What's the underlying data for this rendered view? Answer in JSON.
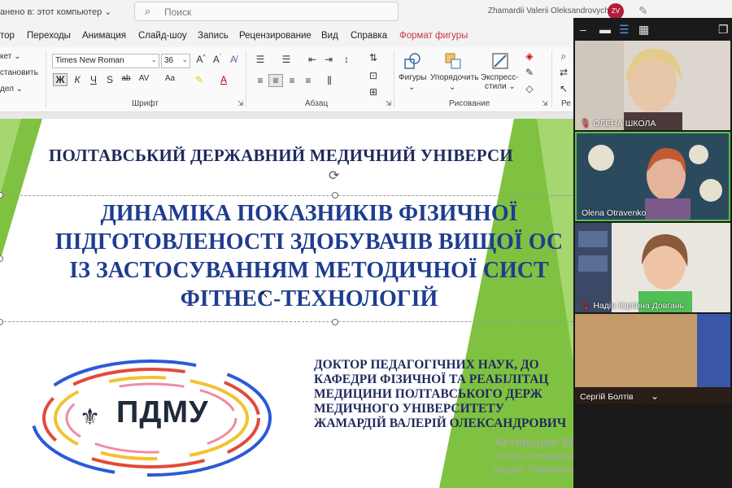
{
  "titlebar": {
    "saved": "анено в: этот компьютер ⌄",
    "search_placeholder": "Поиск",
    "user": "Zhamardii Valerii Oleksandrovych",
    "avatar_initials": "ZV"
  },
  "menu": {
    "items": [
      "тор",
      "Переходы",
      "Анимация",
      "Слайд-шоу",
      "Запись",
      "Рецензирование",
      "Вид",
      "Справка",
      "Формат фигуры"
    ]
  },
  "ribbon": {
    "left_cut": [
      "кет ⌄",
      "становить",
      "дел ⌄"
    ],
    "font_name": "Times New Roman",
    "font_size": "36",
    "group_font": "Шрифт",
    "group_paragraph": "Абзац",
    "group_drawing": "Рисование",
    "group_edit_cut": "Ре",
    "shapes_label": "Фигуры",
    "arrange_label": "Упорядочить",
    "express_label_1": "Экспресс-",
    "express_label_2": "стили ⌄"
  },
  "slide": {
    "university": "ПОЛТАВСЬКИЙ ДЕРЖАВНИЙ МЕДИЧНИЙ УНІВЕРСИ",
    "title_lines": [
      "ДИНАМІКА ПОКАЗНИКІВ ФІЗИЧНОЇ",
      "ПІДГОТОВЛЕНОСТІ ЗДОБУВАЧІВ ВИЩОЇ ОС",
      "ІЗ ЗАСТОСУВАННЯМ МЕТОДИЧНОЇ СИСТ",
      "ФІТНЕС-ТЕХНОЛОГІЙ"
    ],
    "logo_text": "ПДМУ",
    "author_lines": [
      "ДОКТОР ПЕДАГОГІЧНИХ НАУК,  ДО",
      "КАФЕДРИ ФІЗИЧНОЇ ТА РЕАБІЛІТАЦ",
      "МЕДИЦИНИ  ПОЛТАВСЬКОГО ДЕРЖ",
      "МЕДИЧНОГО УНІВЕРСИТЕТУ",
      "ЖАМАРДІЙ ВАЛЕРІЙ ОЛЕКСАНДРОВИЧ"
    ]
  },
  "activation": {
    "title": "Активация Windows",
    "line1": "Чтобы активировать Windows, перейдите в",
    "line2": "раздел \"Параметры\"."
  },
  "participants": [
    {
      "name": "ОЛЕНА ШКОЛА",
      "muted": true
    },
    {
      "name": "Olena Otravenko",
      "muted": false
    },
    {
      "name": "Надія Юріївна Довгань",
      "muted": true
    },
    {
      "name": "Сергій Болтів",
      "muted": false
    }
  ],
  "colors": {
    "slide_green": "#7fc241",
    "title_blue": "#1f3d8f",
    "active_speaker": "#55c24a",
    "accent_menu": "#c4383c"
  }
}
